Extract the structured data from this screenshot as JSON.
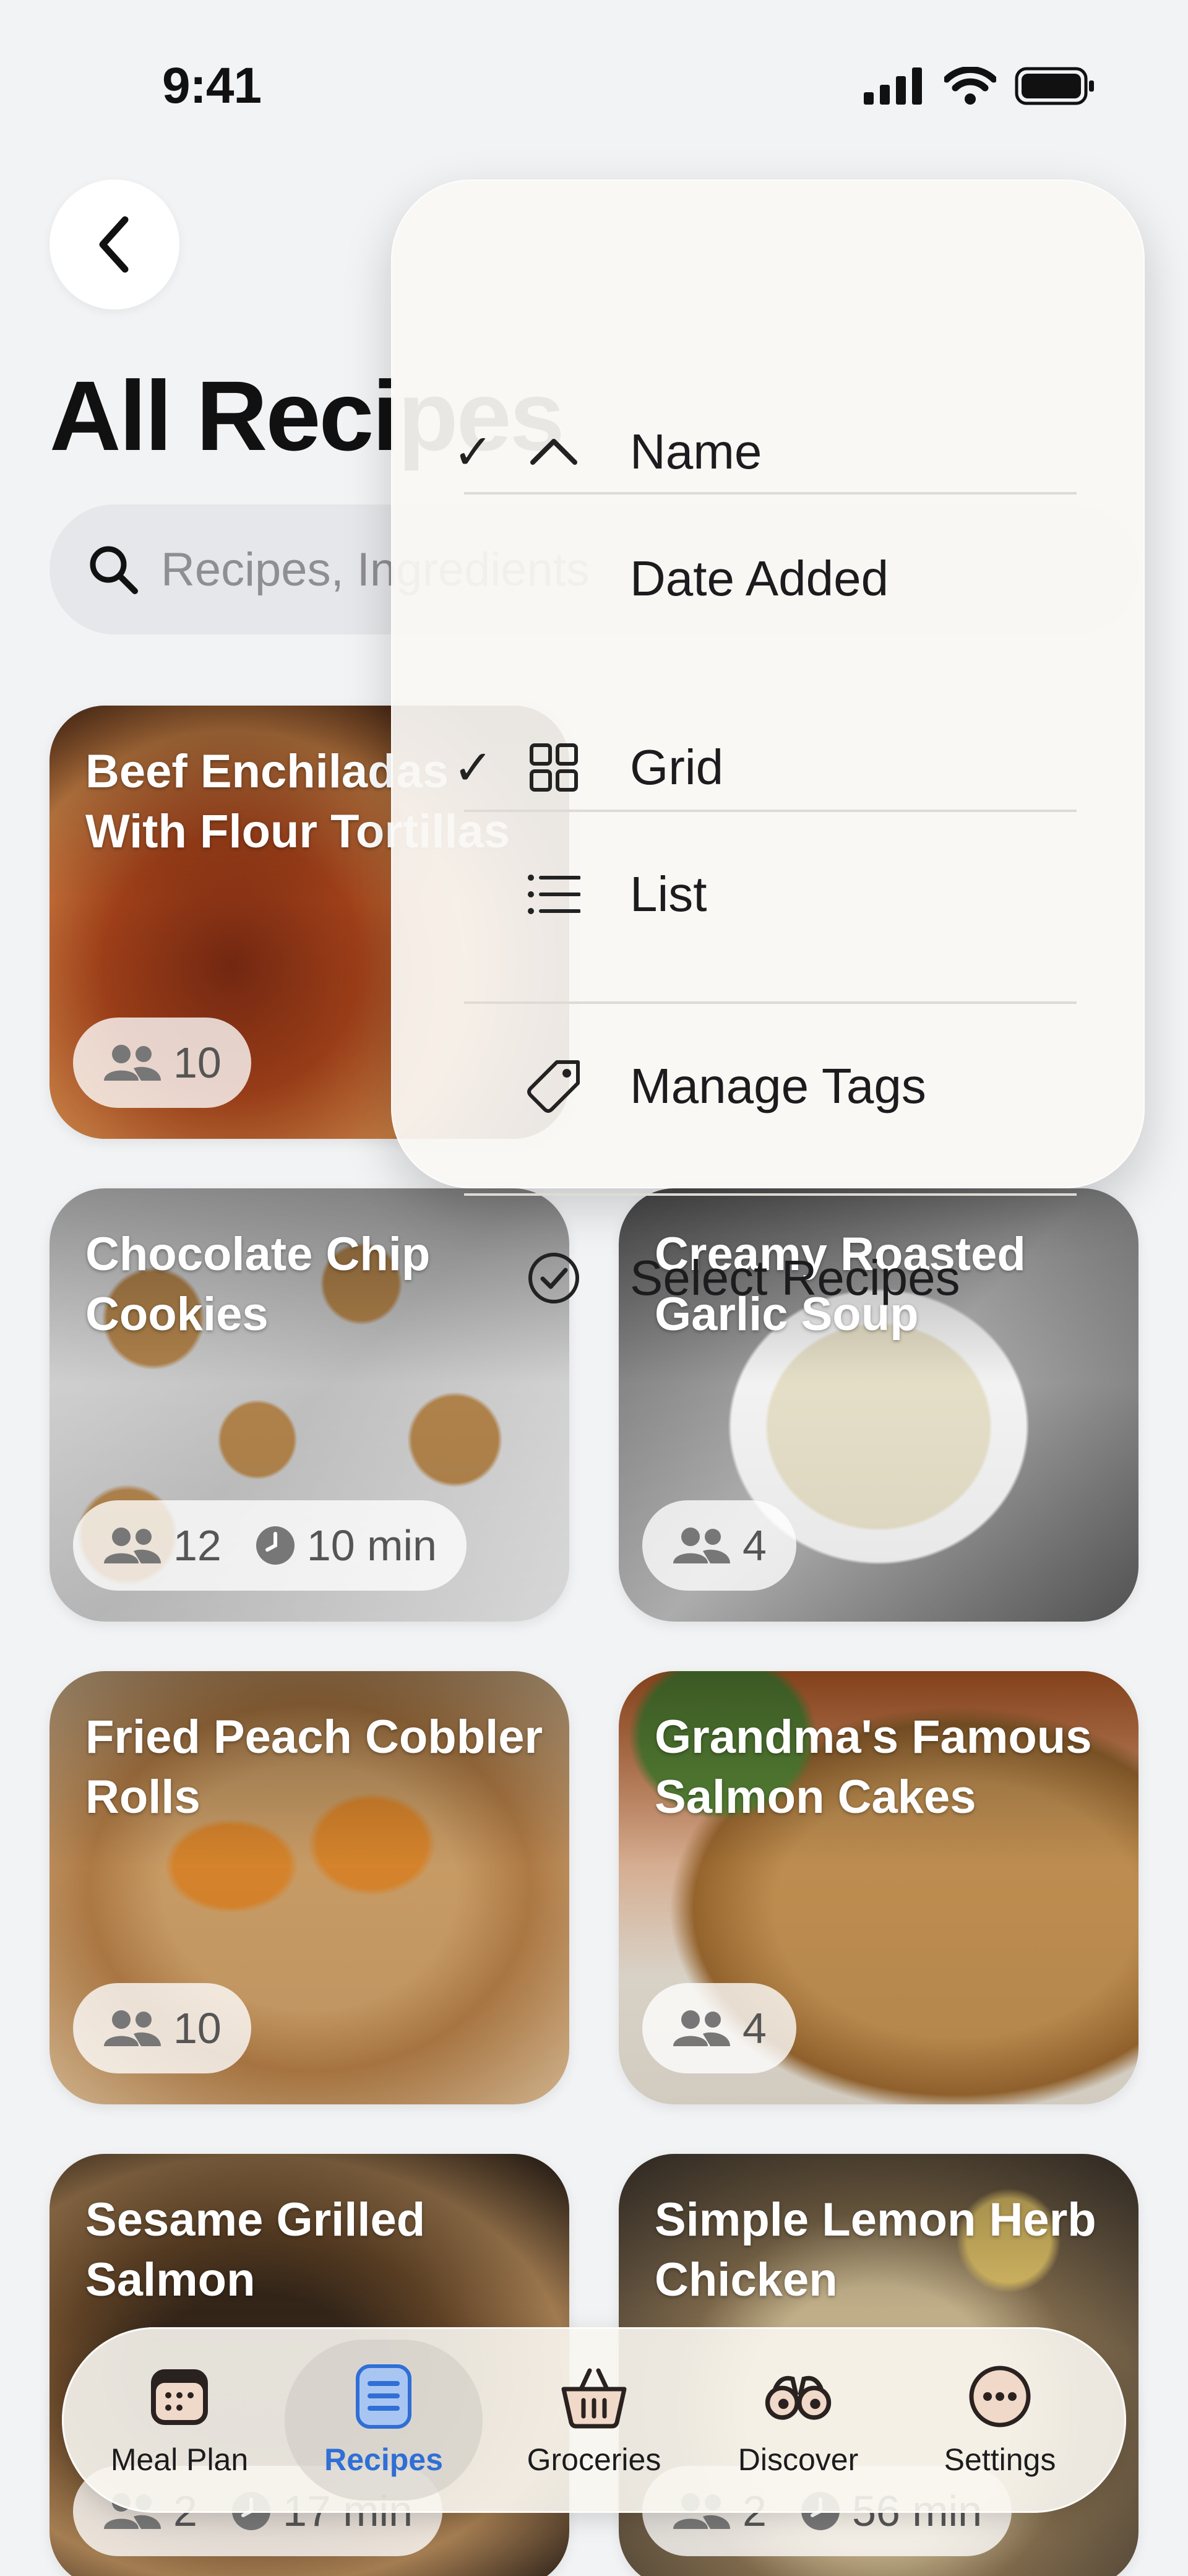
{
  "status": {
    "time": "9:41"
  },
  "header": {
    "title": "All Recipes"
  },
  "search": {
    "placeholder": "Recipes, Ingredients"
  },
  "recipes": [
    {
      "title": "Beef Enchiladas With Flour Tortillas",
      "servings": "10",
      "time": ""
    },
    {
      "title": "Chocolate Chip Cookies",
      "servings": "12",
      "time": "10 min"
    },
    {
      "title": "Creamy Roasted Garlic Soup",
      "servings": "4",
      "time": ""
    },
    {
      "title": "Fried Peach Cobbler Rolls",
      "servings": "10",
      "time": ""
    },
    {
      "title": "Grandma's Famous Salmon Cakes",
      "servings": "4",
      "time": ""
    },
    {
      "title": "Sesame Grilled Salmon",
      "servings": "2",
      "time": "17 min"
    },
    {
      "title": "Simple Lemon Herb Chicken",
      "servings": "2",
      "time": "56 min"
    }
  ],
  "menu": {
    "sort_name": "Name",
    "sort_date": "Date Added",
    "view_grid": "Grid",
    "view_list": "List",
    "manage_tags": "Manage Tags",
    "select_recipes": "Select Recipes",
    "check": "✓"
  },
  "tabs": {
    "meal_plan": "Meal Plan",
    "recipes": "Recipes",
    "groceries": "Groceries",
    "discover": "Discover",
    "settings": "Settings"
  },
  "colors": {
    "accent": "#2f6fd6",
    "background": "#f2f3f5"
  }
}
